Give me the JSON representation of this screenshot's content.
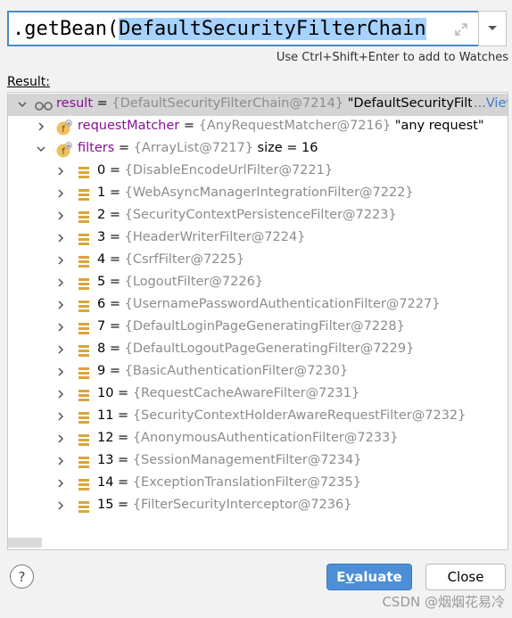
{
  "expression": {
    "prefix": ".getBean(",
    "selected": "DefaultSecurityFilterChain"
  },
  "hint_text": "Use Ctrl+Shift+Enter to add to Watches",
  "result_label": "Result:",
  "tree": {
    "root": {
      "name": "result",
      "eq": " = ",
      "ref": "{DefaultSecurityFilterChain@7214}",
      "value": " \"DefaultSecurityFilte",
      "link": "...View"
    },
    "request_matcher": {
      "name": "requestMatcher",
      "eq": " = ",
      "ref": "{AnyRequestMatcher@7216}",
      "value": " \"any request\""
    },
    "filters": {
      "name": "filters",
      "eq": " = ",
      "ref": "{ArrayList@7217}",
      "value": "  size = 16"
    },
    "items": [
      {
        "index": "0",
        "ref": "{DisableEncodeUrlFilter@7221}"
      },
      {
        "index": "1",
        "ref": "{WebAsyncManagerIntegrationFilter@7222}"
      },
      {
        "index": "2",
        "ref": "{SecurityContextPersistenceFilter@7223}"
      },
      {
        "index": "3",
        "ref": "{HeaderWriterFilter@7224}"
      },
      {
        "index": "4",
        "ref": "{CsrfFilter@7225}"
      },
      {
        "index": "5",
        "ref": "{LogoutFilter@7226}"
      },
      {
        "index": "6",
        "ref": "{UsernamePasswordAuthenticationFilter@7227}"
      },
      {
        "index": "7",
        "ref": "{DefaultLoginPageGeneratingFilter@7228}"
      },
      {
        "index": "8",
        "ref": "{DefaultLogoutPageGeneratingFilter@7229}"
      },
      {
        "index": "9",
        "ref": "{BasicAuthenticationFilter@7230}"
      },
      {
        "index": "10",
        "ref": "{RequestCacheAwareFilter@7231}"
      },
      {
        "index": "11",
        "ref": "{SecurityContextHolderAwareRequestFilter@7232}"
      },
      {
        "index": "12",
        "ref": "{AnonymousAuthenticationFilter@7233}"
      },
      {
        "index": "13",
        "ref": "{SessionManagementFilter@7234}"
      },
      {
        "index": "14",
        "ref": "{ExceptionTranslationFilter@7235}"
      },
      {
        "index": "15",
        "ref": "{FilterSecurityInterceptor@7236}"
      }
    ],
    "item_eq": " = "
  },
  "buttons": {
    "help": "?",
    "evaluate_first": "E",
    "evaluate_underlined": "v",
    "evaluate_rest": "aluate",
    "close": "Close"
  },
  "watermark": "CSDN @烟烟花易冷"
}
